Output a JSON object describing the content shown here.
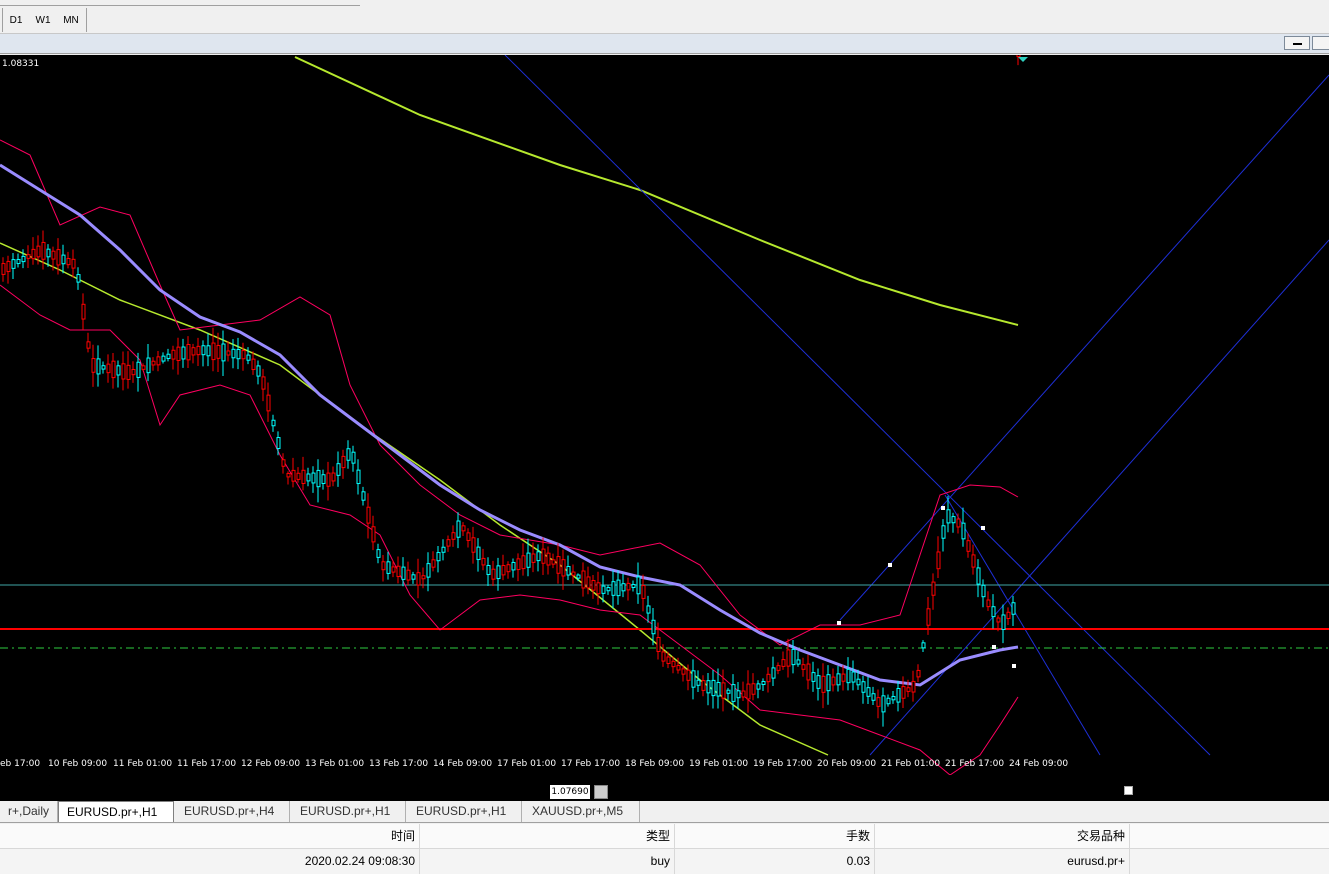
{
  "toolbar": {
    "timeframes": [
      "D1",
      "W1",
      "MN"
    ]
  },
  "chart": {
    "top_price": "1.08331",
    "xaxis_labels": [
      "eb 17:00",
      "10 Feb 09:00",
      "11 Feb 01:00",
      "11 Feb 17:00",
      "12 Feb 09:00",
      "13 Feb 01:00",
      "13 Feb 17:00",
      "14 Feb 09:00",
      "17 Feb 01:00",
      "17 Feb 17:00",
      "18 Feb 09:00",
      "19 Feb 01:00",
      "19 Feb 17:00",
      "20 Feb 09:00",
      "21 Feb 01:00",
      "21 Feb 17:00",
      "24 Feb 09:00"
    ],
    "sub_price": "1.07690",
    "colors": {
      "background": "#000000",
      "bull_candle": "#00ffff",
      "bear_candle": "#ff0000",
      "bollinger": "#ff0060",
      "ma_slow": "#9a8cff",
      "ma_long": "#b6e82e",
      "horizontal_level": "#ff0000",
      "channel": "#1e2fd6"
    }
  },
  "tabs": [
    "r+,Daily",
    "EURUSD.pr+,H1",
    "EURUSD.pr+,H4",
    "EURUSD.pr+,H1",
    "EURUSD.pr+,H1",
    "XAUUSD.pr+,M5"
  ],
  "active_tab": 1,
  "table": {
    "headers": {
      "time": "时间",
      "type": "类型",
      "lots": "手数",
      "symbol": "交易品种"
    },
    "row": {
      "time": "2020.02.24 09:08:30",
      "type": "buy",
      "lots": "0.03",
      "symbol": "eurusd.pr+"
    }
  }
}
